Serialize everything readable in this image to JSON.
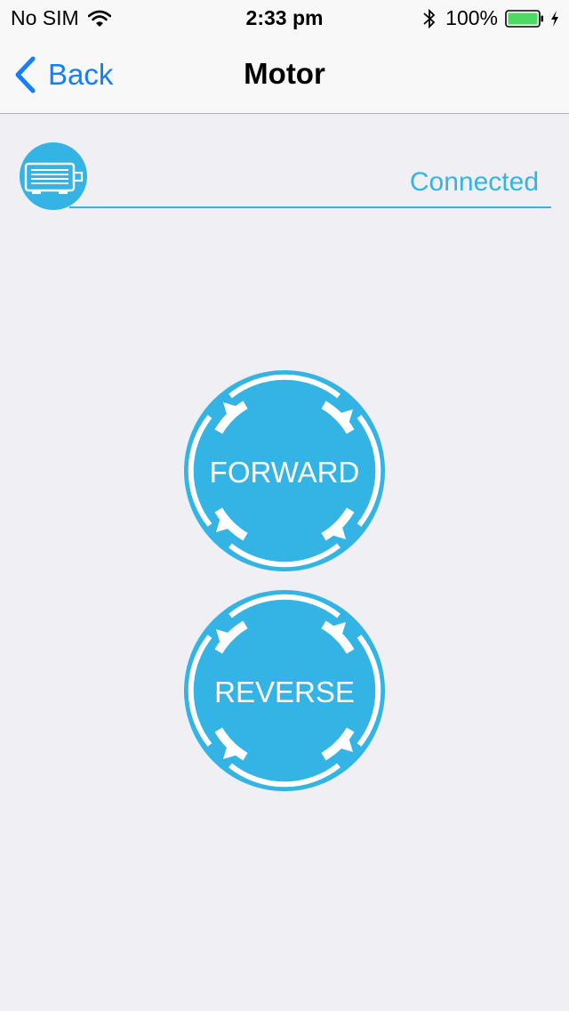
{
  "status_bar": {
    "carrier": "No SIM",
    "time": "2:33 pm",
    "battery_percent": "100%",
    "battery_level": 1.0
  },
  "nav": {
    "back_label": "Back",
    "title": "Motor"
  },
  "device": {
    "status": "Connected",
    "icon": "motor-icon"
  },
  "controls": {
    "forward_label": "FORWARD",
    "reverse_label": "REVERSE"
  },
  "colors": {
    "accent": "#34b4e4",
    "ios_blue": "#157efb",
    "background": "#efeff4"
  }
}
